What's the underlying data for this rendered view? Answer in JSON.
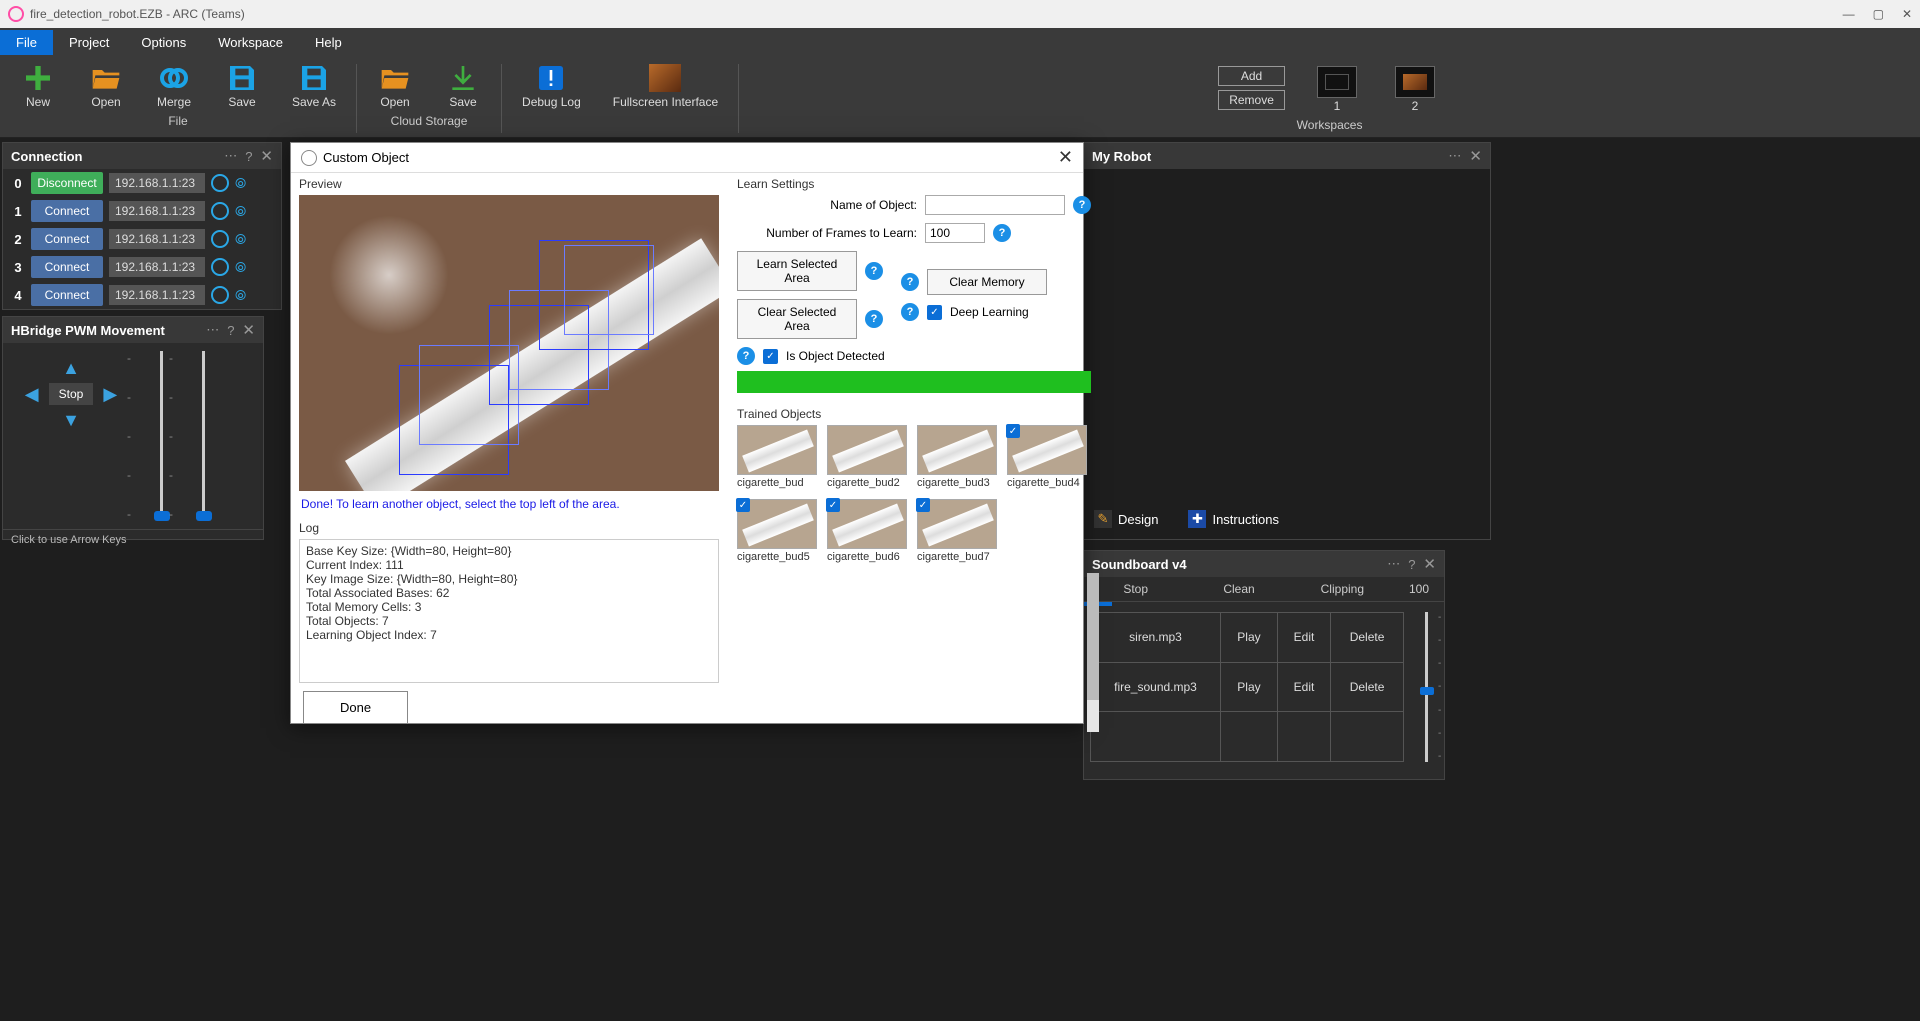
{
  "titlebar": {
    "title": "fire_detection_robot.EZB - ARC (Teams)"
  },
  "menubar": {
    "items": [
      "File",
      "Project",
      "Options",
      "Workspace",
      "Help"
    ],
    "active_index": 0
  },
  "ribbon": {
    "file": {
      "new": "New",
      "open": "Open",
      "merge": "Merge",
      "save": "Save",
      "saveas": "Save As",
      "group": "File"
    },
    "cloud": {
      "open": "Open",
      "save": "Save",
      "group": "Cloud Storage"
    },
    "debug": {
      "label": "Debug Log"
    },
    "fullscreen": {
      "label": "Fullscreen Interface"
    },
    "workspace": {
      "add": "Add",
      "remove": "Remove",
      "one": "1",
      "two": "2",
      "group": "Workspaces"
    }
  },
  "connection": {
    "title": "Connection",
    "rows": [
      {
        "n": "0",
        "btn": "Disconnect",
        "ip": "192.168.1.1:23"
      },
      {
        "n": "1",
        "btn": "Connect",
        "ip": "192.168.1.1:23"
      },
      {
        "n": "2",
        "btn": "Connect",
        "ip": "192.168.1.1:23"
      },
      {
        "n": "3",
        "btn": "Connect",
        "ip": "192.168.1.1:23"
      },
      {
        "n": "4",
        "btn": "Connect",
        "ip": "192.168.1.1:23"
      }
    ]
  },
  "hbridge": {
    "title": "HBridge PWM Movement",
    "stop": "Stop",
    "foot": "Click to use Arrow Keys"
  },
  "myrobot": {
    "title": "My Robot"
  },
  "designtabs": {
    "design": "Design",
    "instructions": "Instructions"
  },
  "soundboard": {
    "title": "Soundboard v4",
    "head": {
      "stop": "Stop",
      "clean": "Clean",
      "clipping": "Clipping",
      "value": "100"
    },
    "rows": [
      {
        "file": "siren.mp3",
        "play": "Play",
        "edit": "Edit",
        "del": "Delete"
      },
      {
        "file": "fire_sound.mp3",
        "play": "Play",
        "edit": "Edit",
        "del": "Delete"
      }
    ]
  },
  "modal": {
    "title": "Custom Object",
    "preview_label": "Preview",
    "learn_label": "Learn Settings",
    "name_label": "Name of Object:",
    "name_value": "",
    "frames_label": "Number of Frames to Learn:",
    "frames_value": "100",
    "learn_btn": "Learn Selected Area",
    "clear_area_btn": "Clear Selected Area",
    "clear_mem_btn": "Clear Memory",
    "deep_label": "Deep Learning",
    "detected_label": "Is Object Detected",
    "trained_label": "Trained Objects",
    "status": "Done! To learn another object, select the top left of the area.",
    "log_label": "Log",
    "log_lines": [
      "Base Key Size: {Width=80, Height=80}",
      "Current Index: 111",
      "Key Image Size: {Width=80, Height=80}",
      "Total Associated Bases: 62",
      "Total Memory Cells: 3",
      "Total Objects: 7",
      "Learning Object Index: 7"
    ],
    "done": "Done",
    "trained": [
      {
        "label": "cigarette_bud",
        "checked": false
      },
      {
        "label": "cigarette_bud2",
        "checked": false
      },
      {
        "label": "cigarette_bud3",
        "checked": false
      },
      {
        "label": "cigarette_bud4",
        "checked": true
      },
      {
        "label": "cigarette_bud5",
        "checked": true
      },
      {
        "label": "cigarette_bud6",
        "checked": true
      },
      {
        "label": "cigarette_bud7",
        "checked": true
      }
    ]
  }
}
